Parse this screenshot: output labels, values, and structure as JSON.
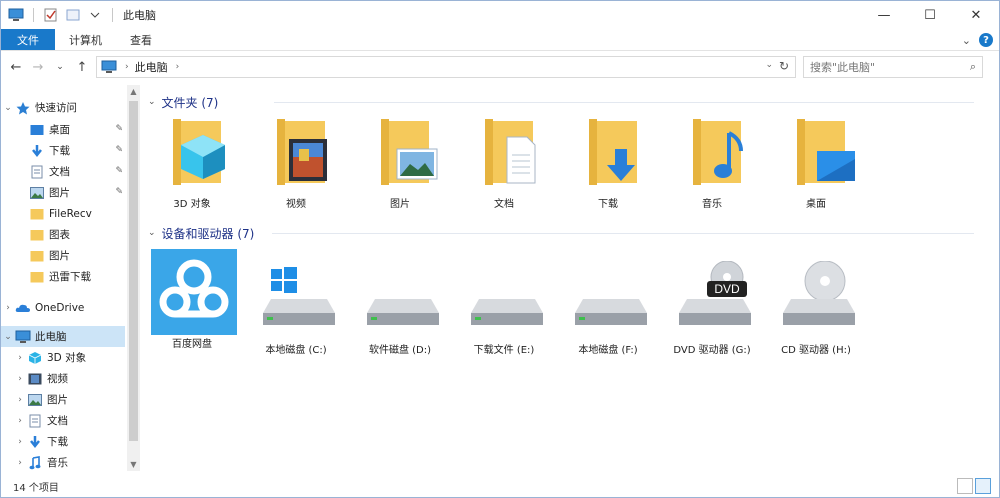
{
  "window": {
    "title": "此电脑"
  },
  "caption": {
    "minimize": "—",
    "maximize": "☐",
    "close": "✕"
  },
  "ribbon": {
    "tabs": [
      "文件",
      "计算机",
      "查看"
    ]
  },
  "address": {
    "crumb": "此电脑",
    "search_placeholder": "搜索\"此电脑\""
  },
  "nav": {
    "quick_access": "快速访问",
    "quick_items": [
      "桌面",
      "下载",
      "文档",
      "图片",
      "FileRecv",
      "图表",
      "图片",
      "迅雷下载"
    ],
    "onedrive": "OneDrive",
    "this_pc": "此电脑",
    "pc_items": [
      "3D 对象",
      "视频",
      "图片",
      "文档",
      "下载",
      "音乐"
    ]
  },
  "folders": {
    "header": "文件夹 (7)",
    "items": [
      "3D 对象",
      "视频",
      "图片",
      "文档",
      "下载",
      "音乐",
      "桌面"
    ]
  },
  "devices": {
    "header": "设备和驱动器 (7)",
    "items": [
      "百度网盘",
      "本地磁盘 (C:)",
      "软件磁盘 (D:)",
      "下载文件 (E:)",
      "本地磁盘 (F:)",
      "DVD 驱动器 (G:)",
      "CD 驱动器 (H:)"
    ],
    "dvd_text": "DVD"
  },
  "status": {
    "count": "14 个项目"
  },
  "colors": {
    "accent": "#1979ca",
    "folder": "#f5c95b",
    "header": "#1e3287"
  }
}
